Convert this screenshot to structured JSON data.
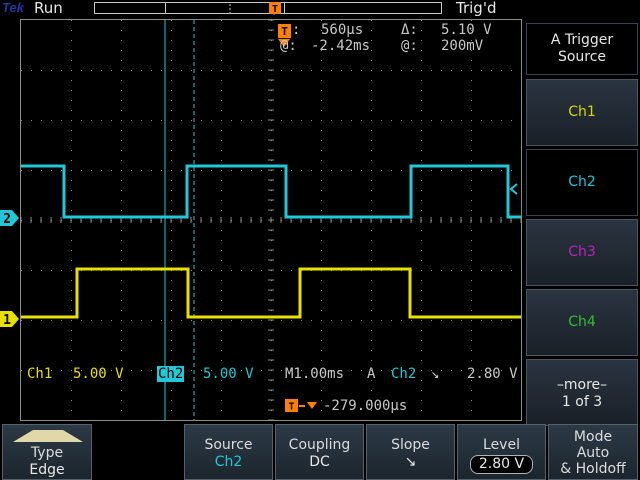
{
  "topbar": {
    "brand": "Tek",
    "run_state": "Run",
    "trigger_state": "Trig'd",
    "trigger_marker": "T"
  },
  "readout": {
    "cursor_time_icon": "T",
    "cursor_time_value": "560µs",
    "at_label_1": "@:",
    "at_value_1": "-2.42ms",
    "delta_label": "Δ:",
    "delta_value": "5.10 V",
    "at_label_2": "@:",
    "at_value_2": "200mV",
    "ch1_label": "Ch1",
    "ch1_scale": "5.00 V",
    "ch2_label": "Ch2",
    "ch2_scale": "5.00 V",
    "horizontal": "M1.00ms",
    "trig_mode": "A",
    "trig_source": "Ch2",
    "trig_slope_glyph": "↘",
    "trig_level": "2.80 V",
    "position_value": "-279.000µs"
  },
  "markers": {
    "ch2": "2",
    "ch1": "1"
  },
  "side_menu": {
    "title_line1": "A Trigger",
    "title_line2": "Source",
    "items": [
      {
        "label": "Ch1",
        "color": "#d8d800"
      },
      {
        "label": "Ch2",
        "color": "#20c8d8"
      },
      {
        "label": "Ch3",
        "color": "#c020c0"
      },
      {
        "label": "Ch4",
        "color": "#30c030"
      }
    ],
    "more_line1": "–more–",
    "more_line2": "1 of 3"
  },
  "bottom_menu": {
    "type_label": "Type",
    "type_value": "Edge",
    "source_label": "Source",
    "source_value": "Ch2",
    "coupling_label": "Coupling",
    "coupling_value": "DC",
    "slope_label": "Slope",
    "slope_value": "↘",
    "level_label": "Level",
    "level_value": "2.80 V",
    "mode_line1": "Mode",
    "mode_line2": "Auto",
    "mode_line3": "& Holdoff"
  },
  "colors": {
    "ch1": "#e8e000",
    "ch2": "#20c8d8",
    "trigger": "#ff8000",
    "grid": "#8c8c8c"
  }
}
